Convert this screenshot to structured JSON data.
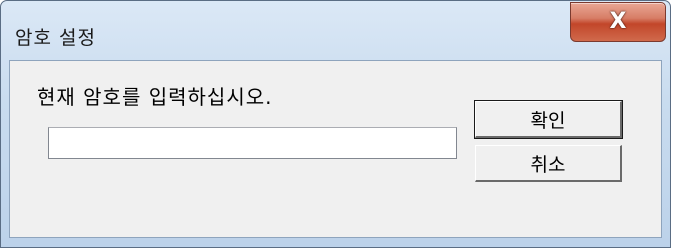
{
  "window": {
    "title": "암호 설정",
    "close_label": "X"
  },
  "dialog": {
    "prompt": "현재 암호를 입력하십시오.",
    "password_value": "",
    "ok_label": "확인",
    "cancel_label": "취소"
  },
  "colors": {
    "close_button": "#c2462a",
    "titlebar": "#c9dcef",
    "client_background": "#f0f0f0"
  }
}
